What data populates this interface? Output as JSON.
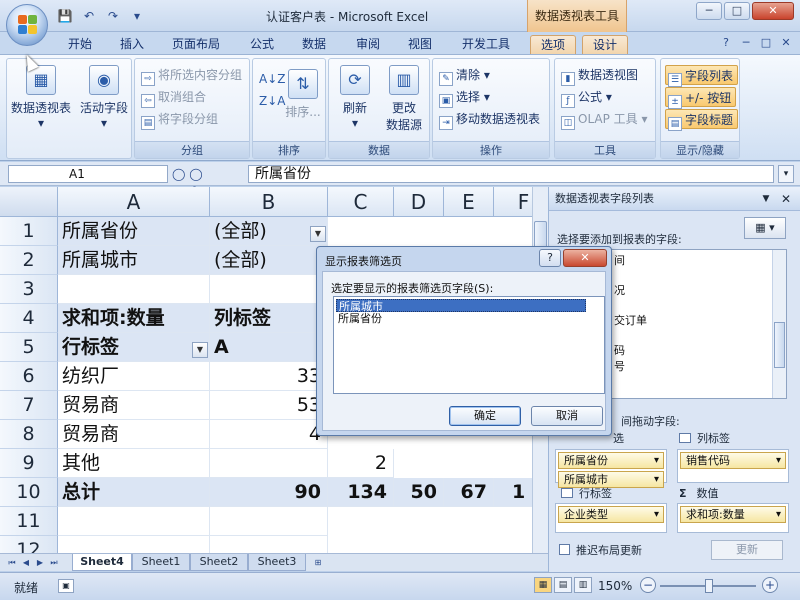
{
  "window": {
    "title": "认证客户表 - Microsoft Excel",
    "context_title": "数据透视表工具",
    "min": "─",
    "max": "□",
    "close": "✕"
  },
  "ribbon_tabs": [
    "开始",
    "插入",
    "页面布局",
    "公式",
    "数据",
    "审阅",
    "视图",
    "开发工具",
    "选项",
    "设计"
  ],
  "ribbon": {
    "pivot_table": "数据透视表",
    "active_field": "活动字段",
    "group_selection": "将所选内容分组",
    "ungroup": "取消组合",
    "group_field": "将字段分组",
    "group_label": "分组",
    "sort": "排序...",
    "sort_label": "排序",
    "refresh": "刷新",
    "change_source_1": "更改",
    "change_source_2": "数据源",
    "data_label": "数据",
    "clear": "清除",
    "select": "选择",
    "move_pivot": "移动数据透视表",
    "actions_label": "操作",
    "pivot_chart": "数据透视图",
    "formulas": "公式",
    "olap_tools": "OLAP 工具",
    "tools_label": "工具",
    "field_list": "字段列表",
    "buttons": "+/- 按钮",
    "field_headers": "字段标题",
    "show_hide_label": "显示/隐藏"
  },
  "formula_bar": {
    "name_box": "A1",
    "fx": "fx",
    "content": "所属省份"
  },
  "columns": [
    "A",
    "B",
    "C",
    "D",
    "E",
    "F"
  ],
  "rows": [
    "1",
    "2",
    "3",
    "4",
    "5",
    "6",
    "7",
    "8",
    "9",
    "10",
    "11",
    "12"
  ],
  "cells": {
    "a1": "所属省份",
    "b1": "(全部)",
    "a2": "所属城市",
    "b2": "(全部)",
    "a4": "求和项:数量",
    "b4": "列标签",
    "a5": "行标签",
    "b5": "A",
    "a6": "纺织厂",
    "b6": "33",
    "a7": "贸易商",
    "b7": "53",
    "a8": "贸易商",
    "b8": "4",
    "a9": "其他",
    "c9": "2",
    "a10": "总计",
    "b10": "90",
    "c10": "134",
    "d10": "50",
    "e10": "67",
    "f10": "1"
  },
  "sheets": [
    "Sheet4",
    "Sheet1",
    "Sheet2",
    "Sheet3"
  ],
  "status": {
    "ready": "就绪",
    "zoom": "150%"
  },
  "field_pane": {
    "title": "数据透视表字段列表",
    "prompt": "选择要添加到报表的字段:",
    "visible_fields": [
      "间",
      "况",
      "交订单",
      "码",
      "号"
    ],
    "drag_prompt": "间拖动字段:",
    "filter_label": "选",
    "column_label": "列标签",
    "row_label": "行标签",
    "values_label": "数值",
    "filter_items": [
      "所属省份",
      "所属城市"
    ],
    "column_items": [
      "销售代码"
    ],
    "row_items": [
      "企业类型"
    ],
    "value_items": [
      "求和项:数量"
    ],
    "defer": "推迟布局更新",
    "update": "更新"
  },
  "dialog": {
    "title": "显示报表筛选页",
    "prompt": "选定要显示的报表筛选页字段(S):",
    "items": [
      "所属城市",
      "所属省份"
    ],
    "selected_index": 0,
    "ok": "确定",
    "cancel": "取消",
    "help": "?",
    "close": "✕"
  }
}
